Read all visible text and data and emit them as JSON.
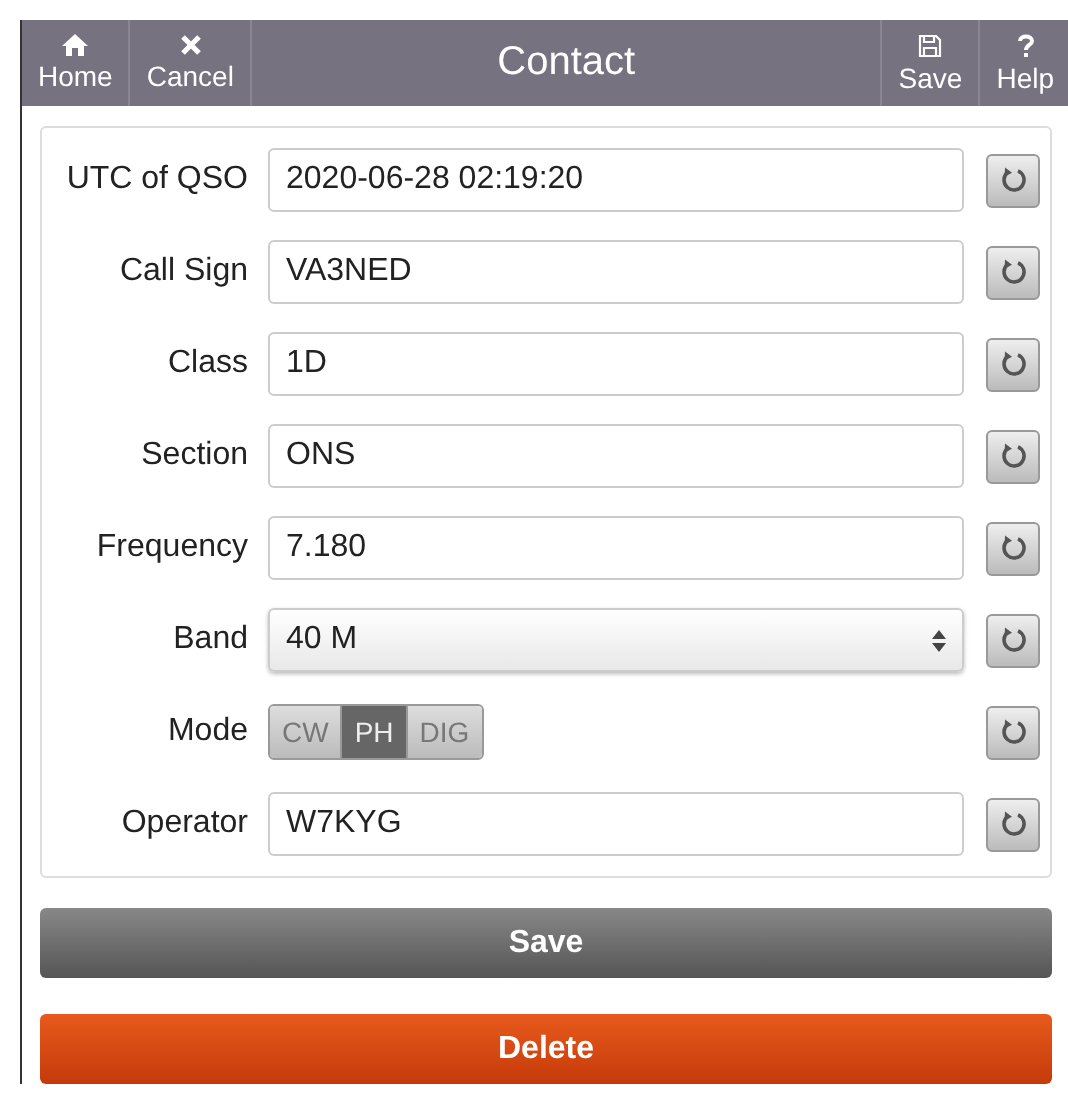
{
  "header": {
    "title": "Contact",
    "left_buttons": [
      {
        "label": "Home"
      },
      {
        "label": "Cancel"
      }
    ],
    "right_buttons": [
      {
        "label": "Save"
      },
      {
        "label": "Help"
      }
    ]
  },
  "fields": [
    {
      "label": "UTC of QSO",
      "kind": "text",
      "value": "2020-06-28 02:19:20"
    },
    {
      "label": "Call Sign",
      "kind": "text",
      "value": "VA3NED"
    },
    {
      "label": "Class",
      "kind": "text",
      "value": "1D"
    },
    {
      "label": "Section",
      "kind": "text",
      "value": "ONS"
    },
    {
      "label": "Frequency",
      "kind": "text",
      "value": "7.180"
    },
    {
      "label": "Band",
      "kind": "select",
      "value": "40 M"
    },
    {
      "label": "Mode",
      "kind": "segmented",
      "options": [
        {
          "label": "CW",
          "selected": false
        },
        {
          "label": "PH",
          "selected": true
        },
        {
          "label": "DIG",
          "selected": false
        }
      ]
    },
    {
      "label": "Operator",
      "kind": "text",
      "value": "W7KYG"
    }
  ],
  "actions": [
    {
      "label": "Save",
      "kind": "primary"
    },
    {
      "label": "Delete",
      "kind": "danger"
    }
  ]
}
